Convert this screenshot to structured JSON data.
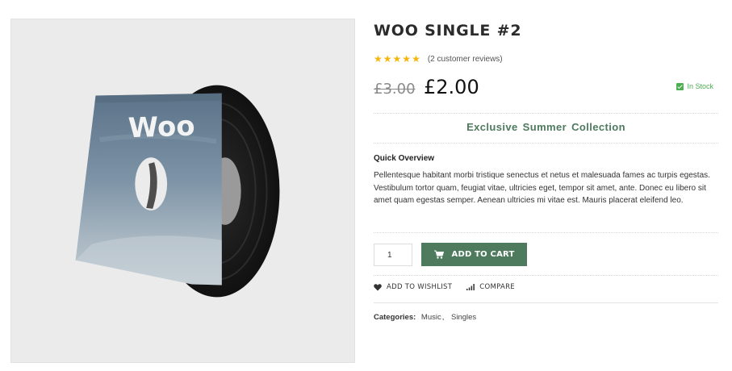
{
  "product": {
    "title": "WOO SINGLE #2",
    "rating": {
      "stars": 5,
      "max": 5,
      "reviews_text": "(2 customer reviews)"
    },
    "old_price": "£3.00",
    "price": "£2.00",
    "stock": "In Stock",
    "collection": "Exclusive Summer Collection",
    "overview_heading": "Quick Overview",
    "overview_text": "Pellentesque habitant morbi tristique senectus et netus et malesuada fames ac turpis egestas. Vestibulum tortor quam, feugiat vitae, ultricies eget, tempor sit amet, ante. Donec eu libero sit amet quam egestas semper. Aenean ultricies mi vitae est. Mauris placerat eleifend leo.",
    "quantity": "1",
    "add_to_cart_label": "ADD TO CART",
    "wishlist_label": "ADD TO WISHLIST",
    "compare_label": "COMPARE",
    "categories_label": "Categories:",
    "categories": [
      "Music",
      "Singles"
    ],
    "image_logo_text": "Woo"
  },
  "colors": {
    "accent": "#4e7a5e",
    "star": "#f5b50a",
    "stock": "#4caf50"
  },
  "icons": {
    "star": "star-icon",
    "stock": "check-icon",
    "cart": "cart-icon",
    "wishlist": "heart-icon",
    "compare": "bar-chart-icon"
  }
}
